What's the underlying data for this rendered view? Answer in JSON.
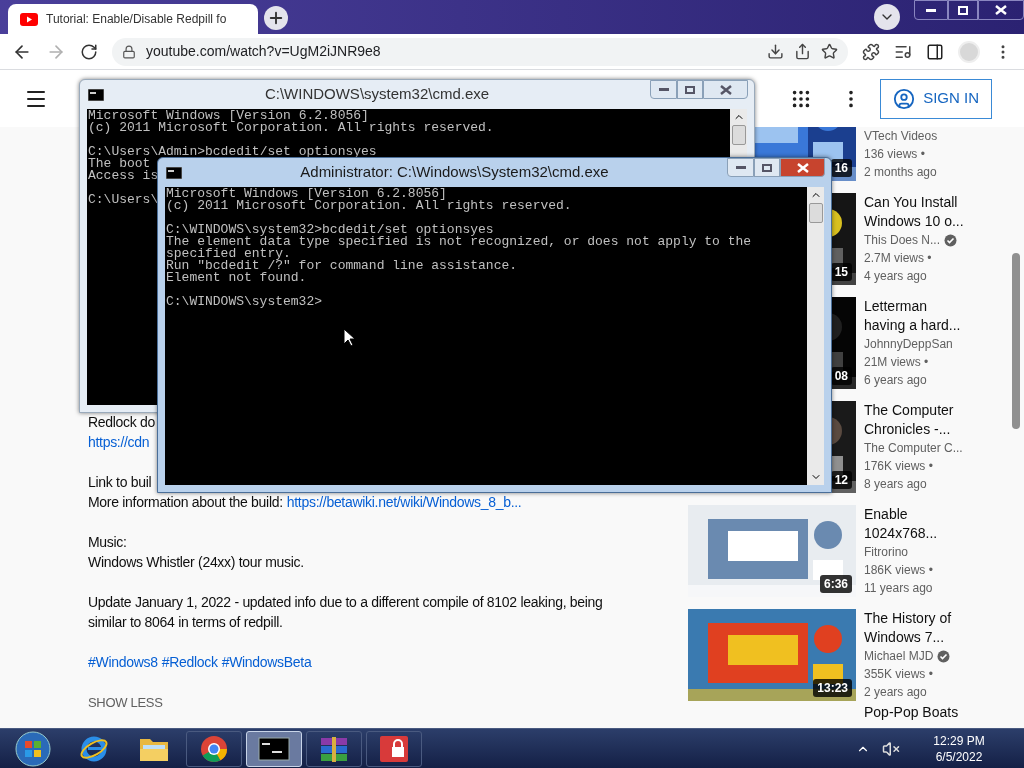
{
  "browser": {
    "tab_title": "Tutorial: Enable/Disable Redpill fo",
    "url": "youtube.com/watch?v=UgM2iJNR9e8"
  },
  "page": {
    "sign_in": "SIGN IN",
    "description": [
      [
        [
          {
            "text": "Redlock do",
            "link": false
          }
        ],
        [
          {
            "text": "https://cdn",
            "link": true
          }
        ]
      ],
      [
        [
          {
            "text": "Link to buil",
            "link": false
          }
        ],
        [
          {
            "text": "More information about the build:",
            "link": false
          },
          {
            "text": "https://betawiki.net/wiki/Windows_8_b...",
            "link": true
          }
        ]
      ],
      [
        [
          {
            "text": "Music:",
            "link": false
          }
        ],
        [
          {
            "text": "Windows Whistler (24xx) tour music.",
            "link": false
          }
        ]
      ],
      [
        [
          {
            "text": "Update January 1, 2022 - updated info due to a different compile of 8102 leaking, being",
            "link": false
          }
        ],
        [
          {
            "text": "similar to 8064 in terms of redpill.",
            "link": false
          }
        ]
      ],
      [
        [
          {
            "text": "#Windows8",
            "link": true
          },
          {
            "text": "#Redlock",
            "link": true
          },
          {
            "text": "#WindowsBeta",
            "link": true
          }
        ]
      ]
    ],
    "show_less": "SHOW LESS",
    "recommendations": [
      {
        "channel": "VTech Videos",
        "verified": false,
        "views": "136 views •",
        "age": "2 months ago",
        "duration": "16"
      },
      {
        "title_lines": [
          "Can You Install",
          "Windows 10 o..."
        ],
        "channel": "This Does N...",
        "verified": true,
        "views": "2.7M views •",
        "age": "4 years ago",
        "duration": "15"
      },
      {
        "title_lines": [
          "Letterman",
          "having a hard..."
        ],
        "channel": "JohnnyDeppSan",
        "verified": false,
        "views": "21M views •",
        "age": "6 years ago",
        "duration": "08"
      },
      {
        "title_lines": [
          "The Computer",
          "Chronicles -..."
        ],
        "channel": "The Computer C...",
        "verified": false,
        "views": "176K views •",
        "age": "8 years ago",
        "duration": "12"
      },
      {
        "title_lines": [
          "Enable",
          "1024x768..."
        ],
        "channel": "Fitrorino",
        "verified": false,
        "views": "186K views •",
        "age": "11 years ago",
        "duration": "6:36"
      },
      {
        "title_lines": [
          "The History of",
          "Windows 7..."
        ],
        "channel": "Michael MJD",
        "verified": true,
        "views": "355K views •",
        "age": "2 years ago",
        "duration": "13:23"
      },
      {
        "title_lines": [
          "Pop-Pop Boats"
        ]
      }
    ]
  },
  "consoles": [
    {
      "title": "C:\\WINDOWS\\system32\\cmd.exe",
      "active": false,
      "blocks": [
        [
          "Microsoft Windows [Version 6.2.8056]",
          "(c) 2011 Microsoft Corporation. All rights reserved."
        ],
        [
          "C:\\Users\\Admin>bcdedit/set optionsyes",
          "The boot",
          "Access is"
        ],
        [
          "C:\\Users\\"
        ]
      ]
    },
    {
      "title": "Administrator: C:\\Windows\\System32\\cmd.exe",
      "active": true,
      "blocks": [
        [
          "Microsoft Windows [Version 6.2.8056]",
          "(c) 2011 Microsoft Corporation. All rights reserved."
        ],
        [
          "C:\\WINDOWS\\system32>bcdedit/set optionsyes",
          "The element data type specified is not recognized, or does not apply to the",
          "specified entry.",
          "Run \"bcdedit /?\" for command line assistance.",
          "Element not found."
        ],
        [
          "C:\\WINDOWS\\system32>"
        ]
      ]
    }
  ],
  "taskbar": {
    "apps": [
      {
        "kind": "ie",
        "selected": false
      },
      {
        "kind": "explorer",
        "selected": false
      },
      {
        "kind": "chrome",
        "selected": false
      },
      {
        "kind": "cmd",
        "selected": true
      },
      {
        "kind": "winrar",
        "selected": false
      },
      {
        "kind": "reader",
        "selected": false
      }
    ],
    "time": "12:29 PM",
    "date": "6/5/2022"
  }
}
